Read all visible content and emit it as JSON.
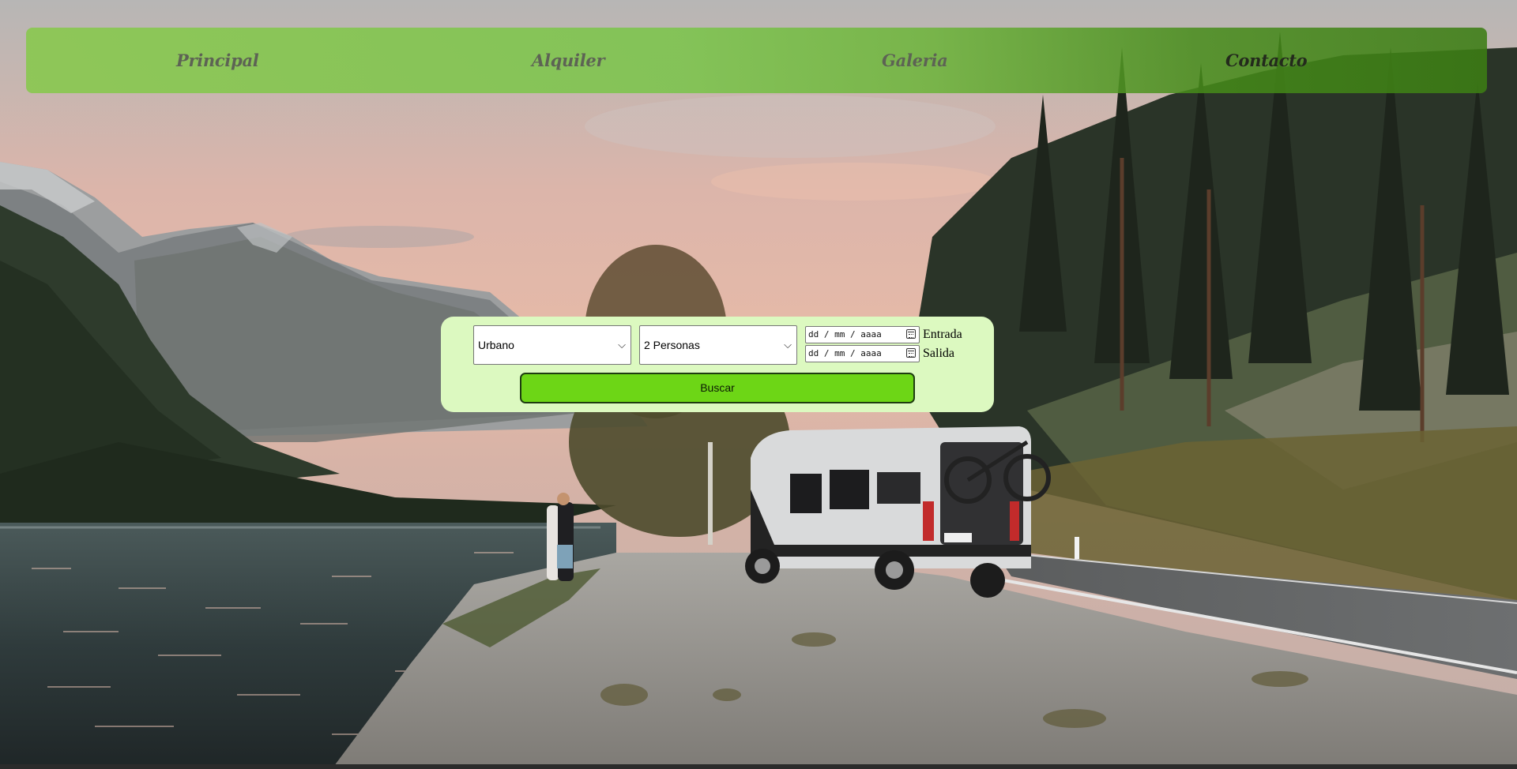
{
  "nav": {
    "items": [
      {
        "label": "Principal"
      },
      {
        "label": "Alquiler"
      },
      {
        "label": "Galeria"
      },
      {
        "label": "Contacto"
      }
    ]
  },
  "search": {
    "type_select": {
      "selected": "Urbano"
    },
    "people_select": {
      "selected": "2 Personas"
    },
    "date_in": {
      "placeholder": "dd / mm / aaaa",
      "label": "Entrada"
    },
    "date_out": {
      "placeholder": "dd / mm / aaaa",
      "label": "Salida"
    },
    "button_label": "Buscar"
  },
  "icons": {
    "select_arrow": "chevron-down-icon",
    "calendar": "calendar-icon"
  },
  "colors": {
    "nav_green": "#7dc44e",
    "panel_bg": "#dcf9c0",
    "button_green": "#6dd616"
  }
}
